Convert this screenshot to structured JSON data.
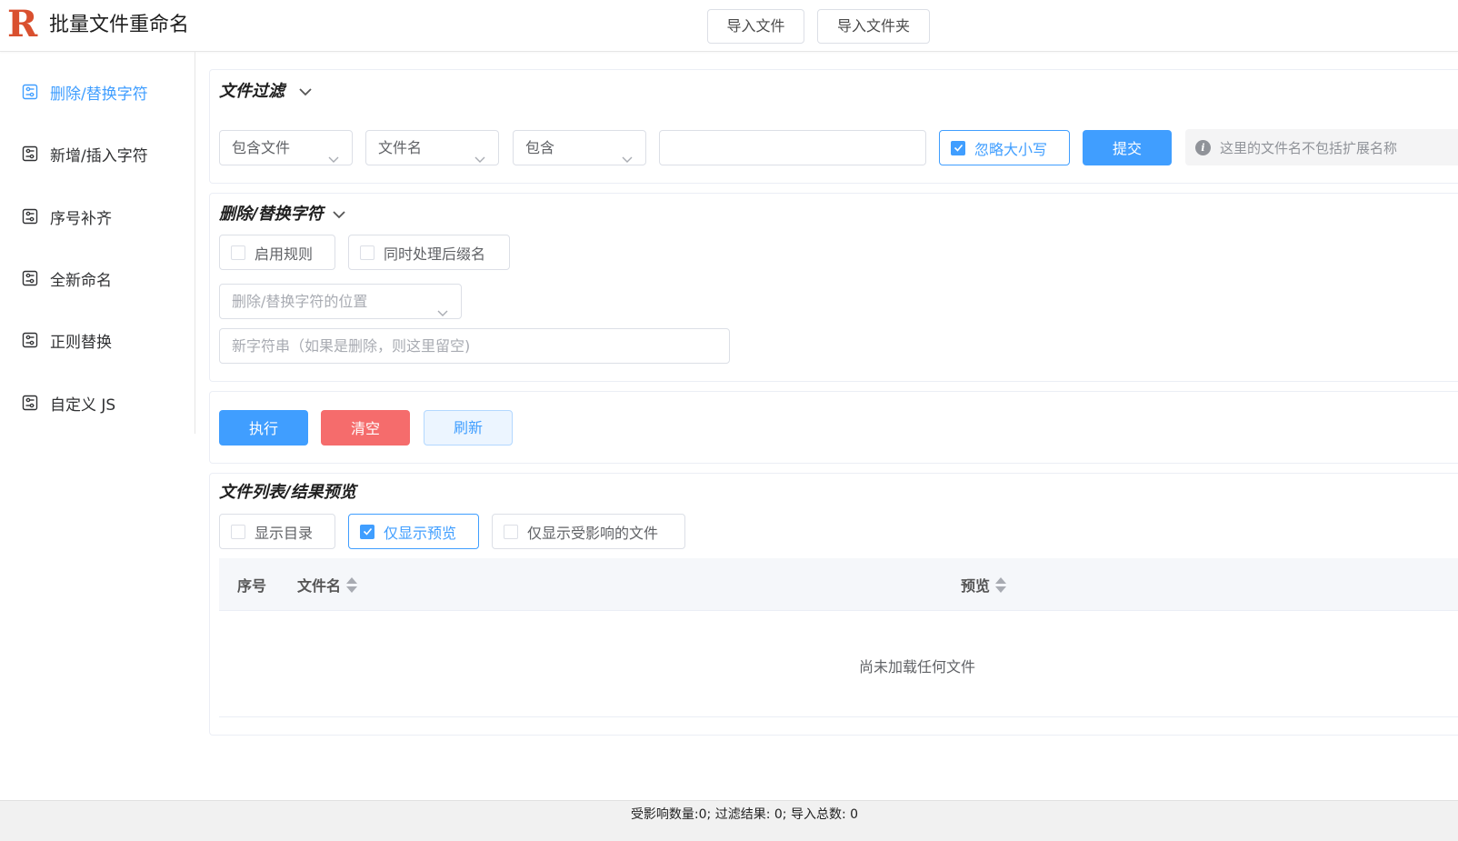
{
  "header": {
    "logo": "R",
    "title": "批量文件重命名",
    "import_files_label": "导入文件",
    "import_folder_label": "导入文件夹"
  },
  "sidebar": {
    "items": [
      {
        "label": "删除/替换字符",
        "active": true
      },
      {
        "label": "新增/插入字符",
        "active": false
      },
      {
        "label": "序号补齐",
        "active": false
      },
      {
        "label": "全新命名",
        "active": false
      },
      {
        "label": "正则替换",
        "active": false
      },
      {
        "label": "自定义 JS",
        "active": false
      }
    ]
  },
  "filter": {
    "title": "文件过滤",
    "mode_value": "包含文件",
    "target_value": "文件名",
    "condition_value": "包含",
    "text_value": "",
    "ignore_case_label": "忽略大小写",
    "ignore_case_checked": true,
    "submit_label": "提交",
    "tip": "这里的文件名不包括扩展名称"
  },
  "rule": {
    "title": "删除/替换字符",
    "enable_label": "启用规则",
    "enable_checked": false,
    "suffix_label": "同时处理后缀名",
    "suffix_checked": false,
    "position_placeholder": "删除/替换字符的位置",
    "new_string_placeholder": "新字符串（如果是删除，则这里留空)"
  },
  "actions": {
    "execute_label": "执行",
    "clear_label": "清空",
    "refresh_label": "刷新"
  },
  "file_list": {
    "title": "文件列表/结果预览",
    "show_dirs_label": "显示目录",
    "show_dirs_checked": false,
    "preview_only_label": "仅显示预览",
    "preview_only_checked": true,
    "affected_only_label": "仅显示受影响的文件",
    "affected_only_checked": false,
    "columns": [
      "序号",
      "文件名",
      "预览"
    ],
    "empty_text": "尚未加载任何文件"
  },
  "status": {
    "text": "受影响数量:0; 过滤结果: 0; 导入总数: 0"
  },
  "colors": {
    "primary": "#409eff",
    "danger": "#f56c6c",
    "logo": "#d9502f"
  }
}
